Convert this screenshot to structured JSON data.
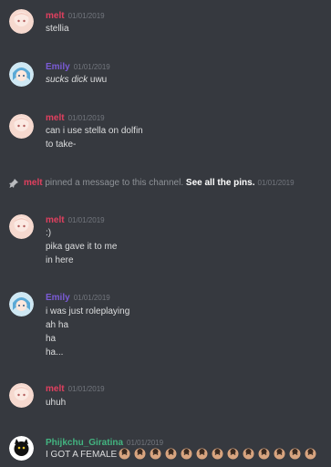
{
  "colors": {
    "background": "#36393f",
    "melt": "#e0405f",
    "emily": "#7b5bd6",
    "phijkchu": "#43b581",
    "text": "#dcddde",
    "timestamp": "#72767d"
  },
  "messages": [
    {
      "author": "melt",
      "timestamp": "01/01/2019",
      "lines": [
        "stellia"
      ]
    },
    {
      "author": "Emily",
      "timestamp": "01/01/2019",
      "italic": "sucks dick",
      "rest": " uwu"
    },
    {
      "author": "melt",
      "timestamp": "01/01/2019",
      "lines": [
        "can i use stella on dolfin",
        "to take-"
      ]
    },
    {
      "author": "melt",
      "timestamp": "01/01/2019",
      "lines": [
        ":)",
        "pika gave it to me",
        "in here"
      ]
    },
    {
      "author": "Emily",
      "timestamp": "01/01/2019",
      "lines": [
        "i was just roleplaying",
        "ah ha",
        "ha",
        "ha..."
      ]
    },
    {
      "author": "melt",
      "timestamp": "01/01/2019",
      "lines": [
        "uhuh"
      ]
    },
    {
      "author": "Phijkchu_Giratina",
      "timestamp": "01/01/2019",
      "lines": [
        "I GOT A FEMALE"
      ]
    }
  ],
  "system": {
    "actor": "melt",
    "action": "pinned a message to this channel.",
    "link": "See all the pins.",
    "timestamp": "01/01/2019"
  },
  "emoji_icon": "face-emoji-icon"
}
